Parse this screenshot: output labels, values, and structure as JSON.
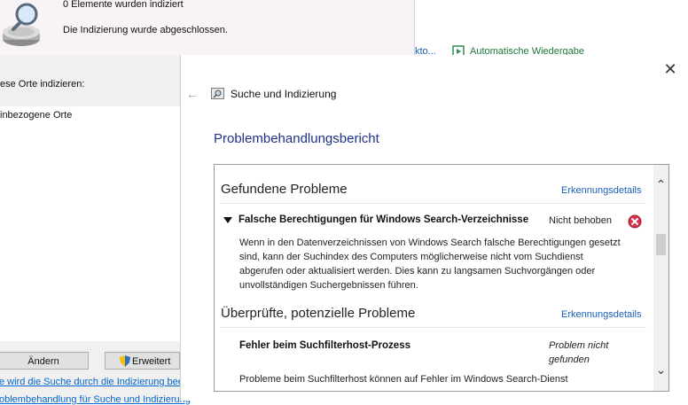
{
  "background_window": {
    "indexed_count_text": "0 Elemente wurden indiziert",
    "indexing_status": "Die Indizierung wurde abgeschlossen.",
    "index_locations_label": "ese Orte indizieren:",
    "included_locations_header": "inbezogene Orte",
    "modify_button": "Ändern",
    "advanced_button": "Erweitert",
    "link_how_search_uses_index": "e wird die Suche durch die Indizierung bee",
    "link_troubleshoot": "oblembehandlung für Suche und Indizierung"
  },
  "control_panel_strip": {
    "partial_item": "kto...",
    "autoplay_link": "Automatische Wiedergabe"
  },
  "dialog": {
    "close_symbol": "✕",
    "back_symbol": "←",
    "title": "Suche und Indizierung",
    "heading": "Problembehandlungsbericht",
    "found_section": {
      "title": "Gefundene Probleme",
      "details_link": "Erkennungsdetails",
      "issues": [
        {
          "title": "Falsche Berechtigungen für Windows Search-Verzeichnisse",
          "status": "Nicht behoben",
          "description": "Wenn in den Datenverzeichnissen von Windows Search falsche Berechtigungen gesetzt sind, kann der Suchindex des Computers möglicherweise nicht vom Suchdienst abgerufen oder aktualisiert werden. Dies kann zu langsamen Suchvorgängen oder unvollständigen Suchergebnissen führen."
        }
      ]
    },
    "checked_section": {
      "title": "Überprüfte, potenzielle Probleme",
      "details_link": "Erkennungsdetails",
      "issues": [
        {
          "title": "Fehler beim Suchfilterhost-Prozess",
          "status": "Problem nicht gefunden",
          "description": "Probleme beim Suchfilterhost können auf Fehler im Windows Search-Dienst"
        }
      ]
    }
  },
  "colors": {
    "heading_blue": "#1e3287",
    "link_blue": "#1a5fb4",
    "error_red": "#d9304a",
    "autoplay_green": "#1f7a3d"
  }
}
